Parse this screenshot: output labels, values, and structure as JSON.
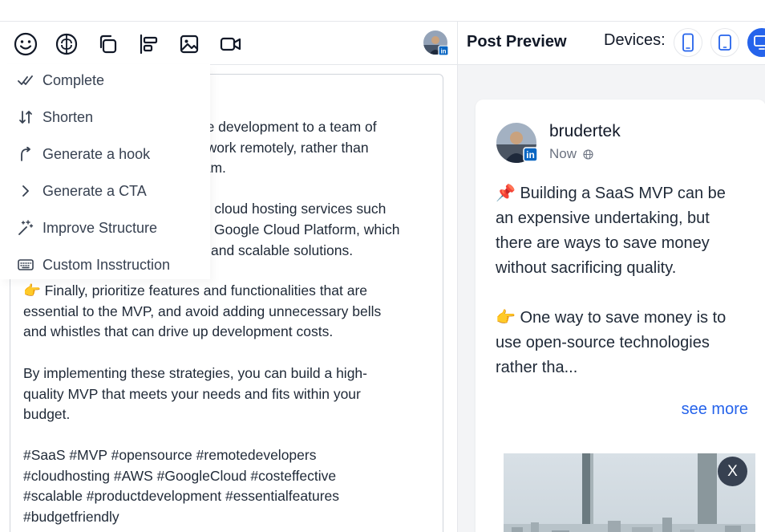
{
  "toolbar": {
    "tools": [
      {
        "icon": "emoji-icon",
        "label": "Emoji"
      },
      {
        "icon": "ai-brain-icon",
        "label": "AI assistant"
      },
      {
        "icon": "copy-icon",
        "label": "Copy"
      },
      {
        "icon": "align-left-icon",
        "label": "Format"
      },
      {
        "icon": "image-icon",
        "label": "Add image"
      },
      {
        "icon": "video-icon",
        "label": "Add video"
      }
    ]
  },
  "ai_menu": {
    "items": [
      {
        "icon": "double-check-icon",
        "label": "Complete"
      },
      {
        "icon": "sort-arrows-icon",
        "label": "Shorten"
      },
      {
        "icon": "hook-arrow-icon",
        "label": "Generate a hook"
      },
      {
        "icon": "chevron-right-icon",
        "label": "Generate a CTA"
      },
      {
        "icon": "magic-wand-icon",
        "label": "Improve Structure"
      },
      {
        "icon": "keyboard-icon",
        "label": "Custom Insstruction"
      }
    ]
  },
  "editor": {
    "partial_line_1": "rce development to a team of",
    "partial_line_2": "o work remotely, rather than",
    "partial_line_3": "eam.",
    "partial_line_4": "ng cloud hosting services such",
    "partial_line_5": "Google Cloud Platform, which",
    "partial_line_6": "and scalable solutions.",
    "paragraph_features": "👉 Finally, prioritize features and functionalities that are\nessential to the MVP, and avoid adding unnecessary bells\nand whistles that can drive up development costs.",
    "paragraph_closing": "By implementing these strategies, you can build a high-\nquality MVP that meets your needs and fits within your\nbudget.",
    "hashtags": "#SaaS #MVP #opensource #remotedevelopers\n#cloudhosting #AWS #GoogleCloud #costeffective\n#scalable #productdevelopment #essentialfeatures\n#budgetfriendly"
  },
  "preview": {
    "title": "Post Preview",
    "devices_label": "Devices:",
    "devices": [
      {
        "icon": "phone-icon",
        "active": false
      },
      {
        "icon": "tablet-icon",
        "active": false
      },
      {
        "icon": "desktop-icon",
        "active": true
      }
    ],
    "author": "brudertek",
    "time": "Now",
    "body": "📌 Building a SaaS MVP can be\nan expensive undertaking, but\nthere are ways to save money\nwithout sacrificing quality.\n\n👉 One way to save money is to\nuse open-source technologies\nrather tha...",
    "see_more": "see more",
    "close_label": "X"
  },
  "colors": {
    "accent": "#2563eb",
    "linkedin": "#0a66c2",
    "preview_bg": "#f3f4f6",
    "close_button": "#374151"
  }
}
